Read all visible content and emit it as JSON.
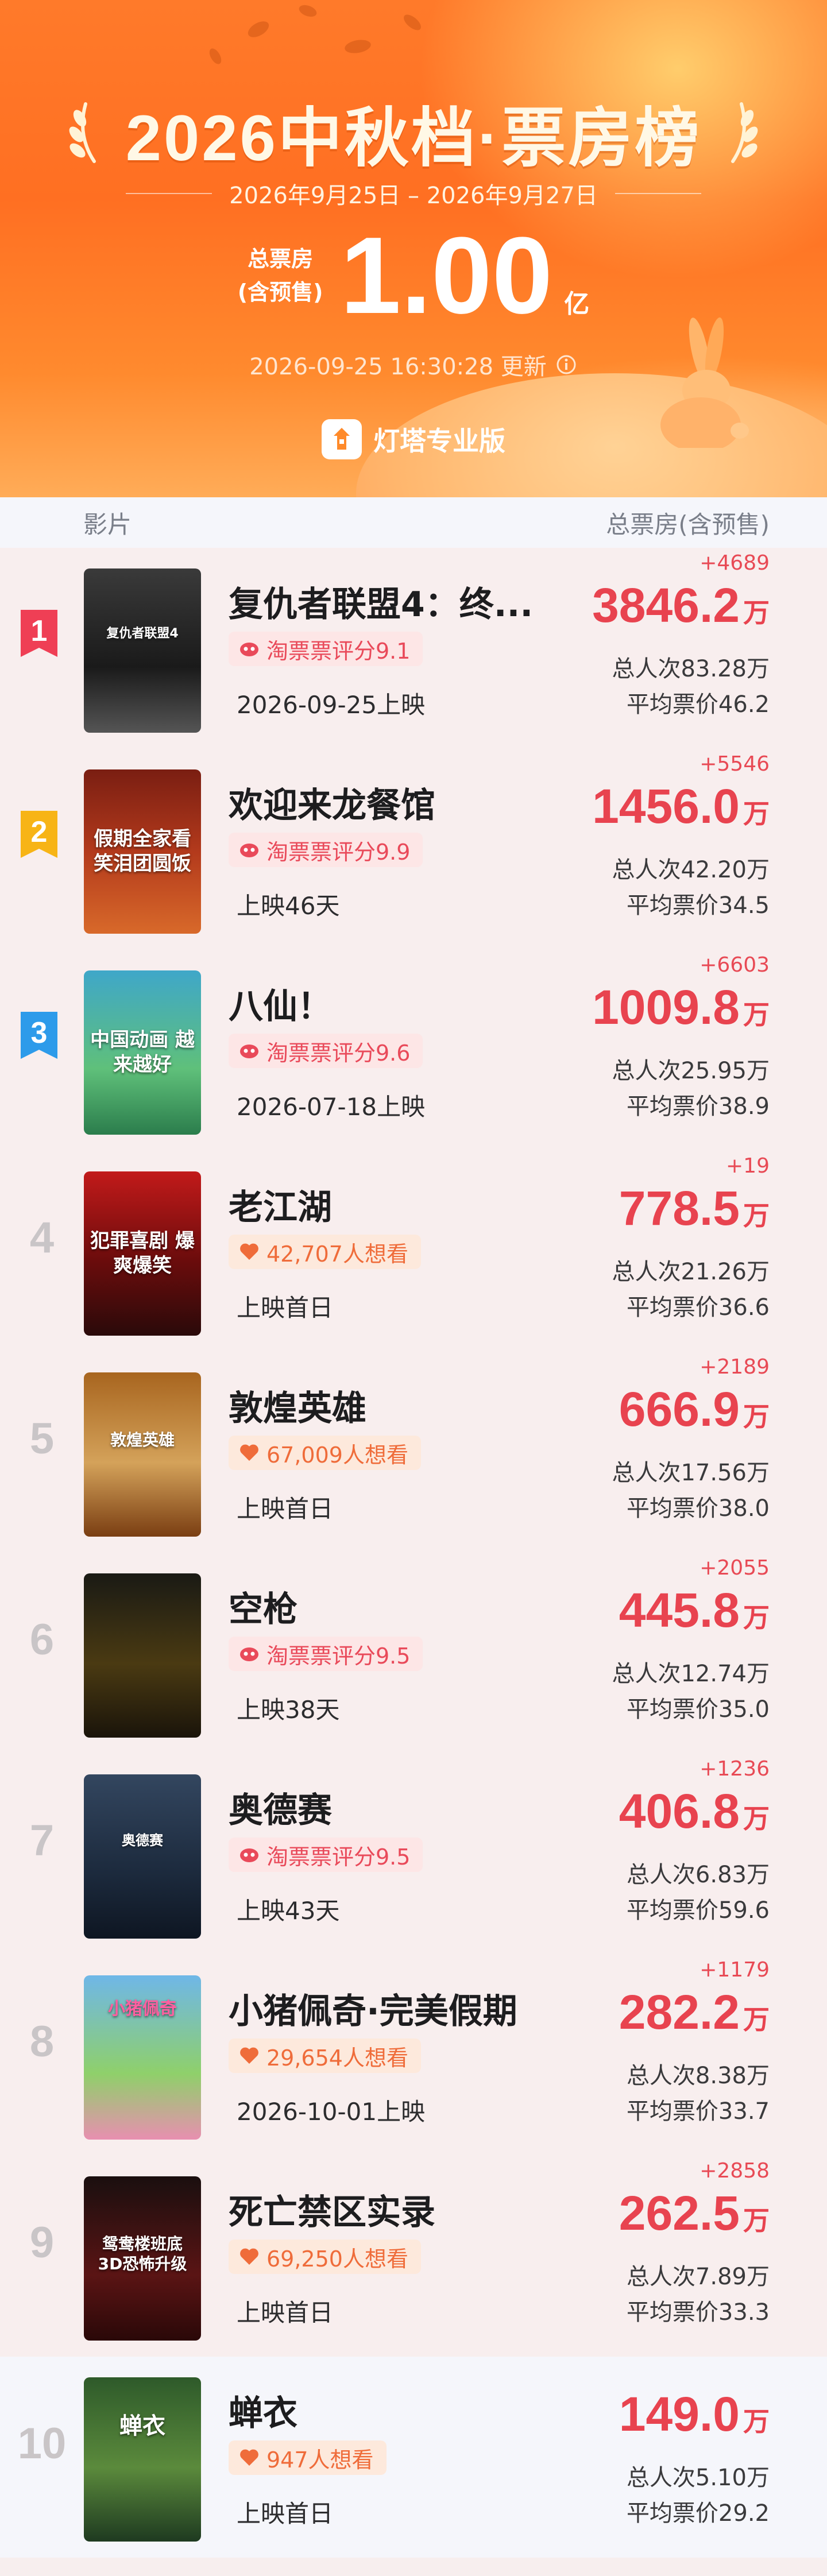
{
  "header": {
    "title": "2026中秋档·票房榜",
    "date_range": "2026年9月25日 – 2026年9月27日",
    "total_label_line1": "总票房",
    "total_label_line2": "(含预售)",
    "total_value": "1.00",
    "total_unit": "亿",
    "update_time": "2026-09-25 16:30:28 更新",
    "brand": "灯塔专业版"
  },
  "table_header": {
    "col_movie": "影片",
    "col_gross": "总票房(含预售)"
  },
  "colors": {
    "accent_red": "#e8434f",
    "rank1": "#ef3f55",
    "rank2": "#f7b416",
    "rank3": "#2d9bea"
  },
  "movies": [
    {
      "rank": "1",
      "name": "复仇者联盟4：终...",
      "tag_type": "rating",
      "tag": "淘票票评分9.1",
      "date": "2026-09-25上映",
      "delta": "+4689",
      "gross": "3846.2",
      "unit": "万",
      "people": "总人次83.28万",
      "price": "平均票价46.2",
      "poster_text": "复仇者联盟4"
    },
    {
      "rank": "2",
      "name": "欢迎来龙餐馆",
      "tag_type": "rating",
      "tag": "淘票票评分9.9",
      "date": "上映46天",
      "delta": "+5546",
      "gross": "1456.0",
      "unit": "万",
      "people": "总人次42.20万",
      "price": "平均票价34.5",
      "poster_text": "假期全家看 笑泪团圆饭"
    },
    {
      "rank": "3",
      "name": "八仙！",
      "tag_type": "rating",
      "tag": "淘票票评分9.6",
      "date": "2026-07-18上映",
      "delta": "+6603",
      "gross": "1009.8",
      "unit": "万",
      "people": "总人次25.95万",
      "price": "平均票价38.9",
      "poster_text": "中国动画 越来越好"
    },
    {
      "rank": "4",
      "name": "老江湖",
      "tag_type": "want",
      "tag": "42,707人想看",
      "date": "上映首日",
      "delta": "+19",
      "gross": "778.5",
      "unit": "万",
      "people": "总人次21.26万",
      "price": "平均票价36.6",
      "poster_text": "犯罪喜剧 爆爽爆笑"
    },
    {
      "rank": "5",
      "name": "敦煌英雄",
      "tag_type": "want",
      "tag": "67,009人想看",
      "date": "上映首日",
      "delta": "+2189",
      "gross": "666.9",
      "unit": "万",
      "people": "总人次17.56万",
      "price": "平均票价38.0",
      "poster_text": "敦煌英雄"
    },
    {
      "rank": "6",
      "name": "空枪",
      "tag_type": "rating",
      "tag": "淘票票评分9.5",
      "date": "上映38天",
      "delta": "+2055",
      "gross": "445.8",
      "unit": "万",
      "people": "总人次12.74万",
      "price": "平均票价35.0",
      "poster_text": ""
    },
    {
      "rank": "7",
      "name": "奥德赛",
      "tag_type": "rating",
      "tag": "淘票票评分9.5",
      "date": "上映43天",
      "delta": "+1236",
      "gross": "406.8",
      "unit": "万",
      "people": "总人次6.83万",
      "price": "平均票价59.6",
      "poster_text": "奥德赛"
    },
    {
      "rank": "8",
      "name": "小猪佩奇·完美假期",
      "tag_type": "want",
      "tag": "29,654人想看",
      "date": "2026-10-01上映",
      "delta": "+1179",
      "gross": "282.2",
      "unit": "万",
      "people": "总人次8.38万",
      "price": "平均票价33.7",
      "poster_text": "小猪佩奇"
    },
    {
      "rank": "9",
      "name": "死亡禁区实录",
      "tag_type": "want",
      "tag": "69,250人想看",
      "date": "上映首日",
      "delta": "+2858",
      "gross": "262.5",
      "unit": "万",
      "people": "总人次7.89万",
      "price": "平均票价33.3",
      "poster_text": "鸳鸯楼班底 3D恐怖升级"
    },
    {
      "rank": "10",
      "name": "蝉衣",
      "tag_type": "want",
      "tag": "947人想看",
      "date": "上映首日",
      "delta": "",
      "gross": "149.0",
      "unit": "万",
      "people": "总人次5.10万",
      "price": "平均票价29.2",
      "poster_text": "蝉衣"
    }
  ]
}
